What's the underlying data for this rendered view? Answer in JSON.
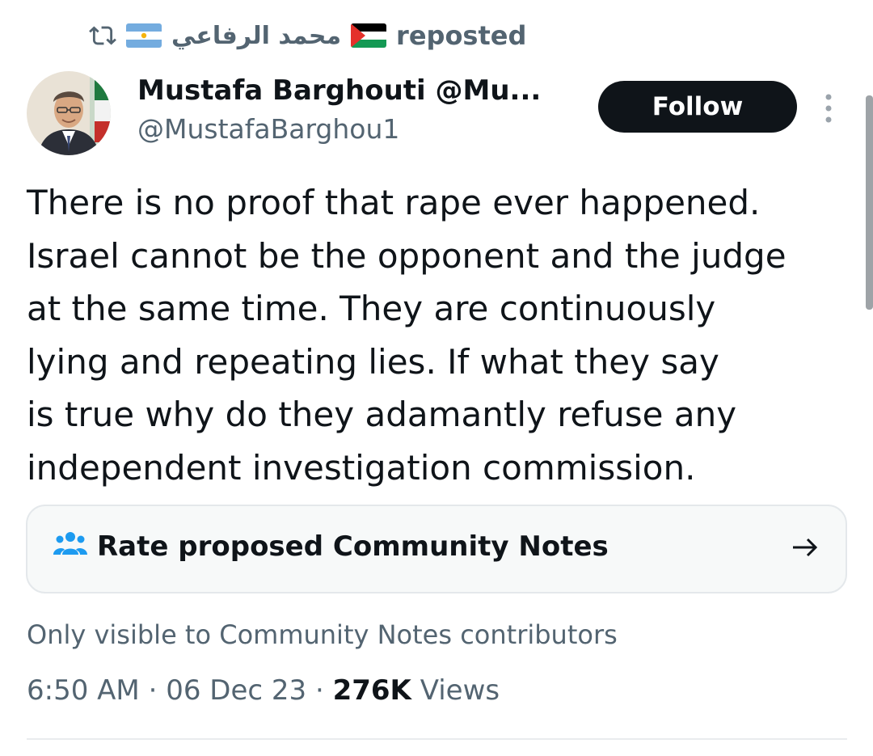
{
  "repost": {
    "icon": "repost-icon",
    "left_flag": "argentina-flag",
    "reposter_name": "محمد الرفاعي",
    "right_flag": "palestine-flag",
    "label": "reposted"
  },
  "author": {
    "avatar": "avatar",
    "display_name": "Mustafa Barghouti @Mu...",
    "handle": "@MustafaBarghou1"
  },
  "actions": {
    "follow_label": "Follow",
    "more_icon": "more-vertical-icon"
  },
  "tweet": {
    "text": "There is no proof that  rape ever happened.\nIsrael cannot be the opponent and the judge\nat the same time. They are continuously\nlying and repeating lies. If what they say\nis true why do they adamantly refuse any\nindependent investigation commission."
  },
  "community_notes": {
    "icon": "people-icon",
    "label": "Rate proposed Community Notes",
    "arrow_icon": "arrow-right-icon",
    "visibility_note": "Only visible to Community Notes contributors"
  },
  "meta": {
    "time": "6:50 AM",
    "separator": "·",
    "date": "06 Dec 23",
    "views_count": "276K",
    "views_label": "Views"
  },
  "colors": {
    "text_primary": "#0f1419",
    "text_secondary": "#536471",
    "follow_bg": "#0f1419",
    "card_bg": "#f7f9f9",
    "card_border": "#e4e8eb",
    "community_icon": "#1d9bf0"
  }
}
